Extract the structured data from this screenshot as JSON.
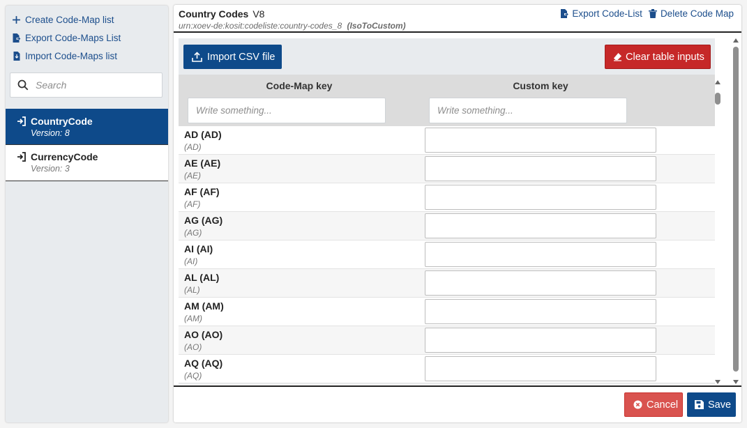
{
  "sidebar": {
    "actions": [
      {
        "label": "Create Code-Map list",
        "icon": "plus-icon"
      },
      {
        "label": "Export Code-Maps List",
        "icon": "file-export-icon"
      },
      {
        "label": "Import Code-Maps list",
        "icon": "file-import-icon"
      }
    ],
    "search": {
      "placeholder": "Search"
    },
    "code_lists": [
      {
        "name": "CountryCode",
        "version": "Version: 8",
        "active": true
      },
      {
        "name": "CurrencyCode",
        "version": "Version: 3",
        "active": false
      }
    ]
  },
  "header": {
    "title": "Country Codes",
    "version": "V8",
    "urn": "urn:xoev-de:kosit:codeliste:country-codes_8",
    "mapping": "(IsoToCustom)",
    "export_label": "Export Code-List",
    "delete_label": "Delete Code Map"
  },
  "toolbar": {
    "import_label": "Import CSV file",
    "clear_label": "Clear table inputs"
  },
  "table": {
    "columns": [
      "Code-Map key",
      "Custom key"
    ],
    "filter_placeholder": "Write something...",
    "rows": [
      {
        "code": "AD (AD)",
        "sub": "(AD)",
        "value": ""
      },
      {
        "code": "AE (AE)",
        "sub": "(AE)",
        "value": ""
      },
      {
        "code": "AF (AF)",
        "sub": "(AF)",
        "value": ""
      },
      {
        "code": "AG (AG)",
        "sub": "(AG)",
        "value": ""
      },
      {
        "code": "AI (AI)",
        "sub": "(AI)",
        "value": ""
      },
      {
        "code": "AL (AL)",
        "sub": "(AL)",
        "value": ""
      },
      {
        "code": "AM (AM)",
        "sub": "(AM)",
        "value": ""
      },
      {
        "code": "AO (AO)",
        "sub": "(AO)",
        "value": ""
      },
      {
        "code": "AQ (AQ)",
        "sub": "(AQ)",
        "value": ""
      }
    ]
  },
  "footer": {
    "cancel_label": "Cancel",
    "save_label": "Save"
  },
  "colors": {
    "primary": "#0e4a8a",
    "danger": "#c62828",
    "cancel": "#d9534f",
    "link": "#1c4e8c"
  }
}
